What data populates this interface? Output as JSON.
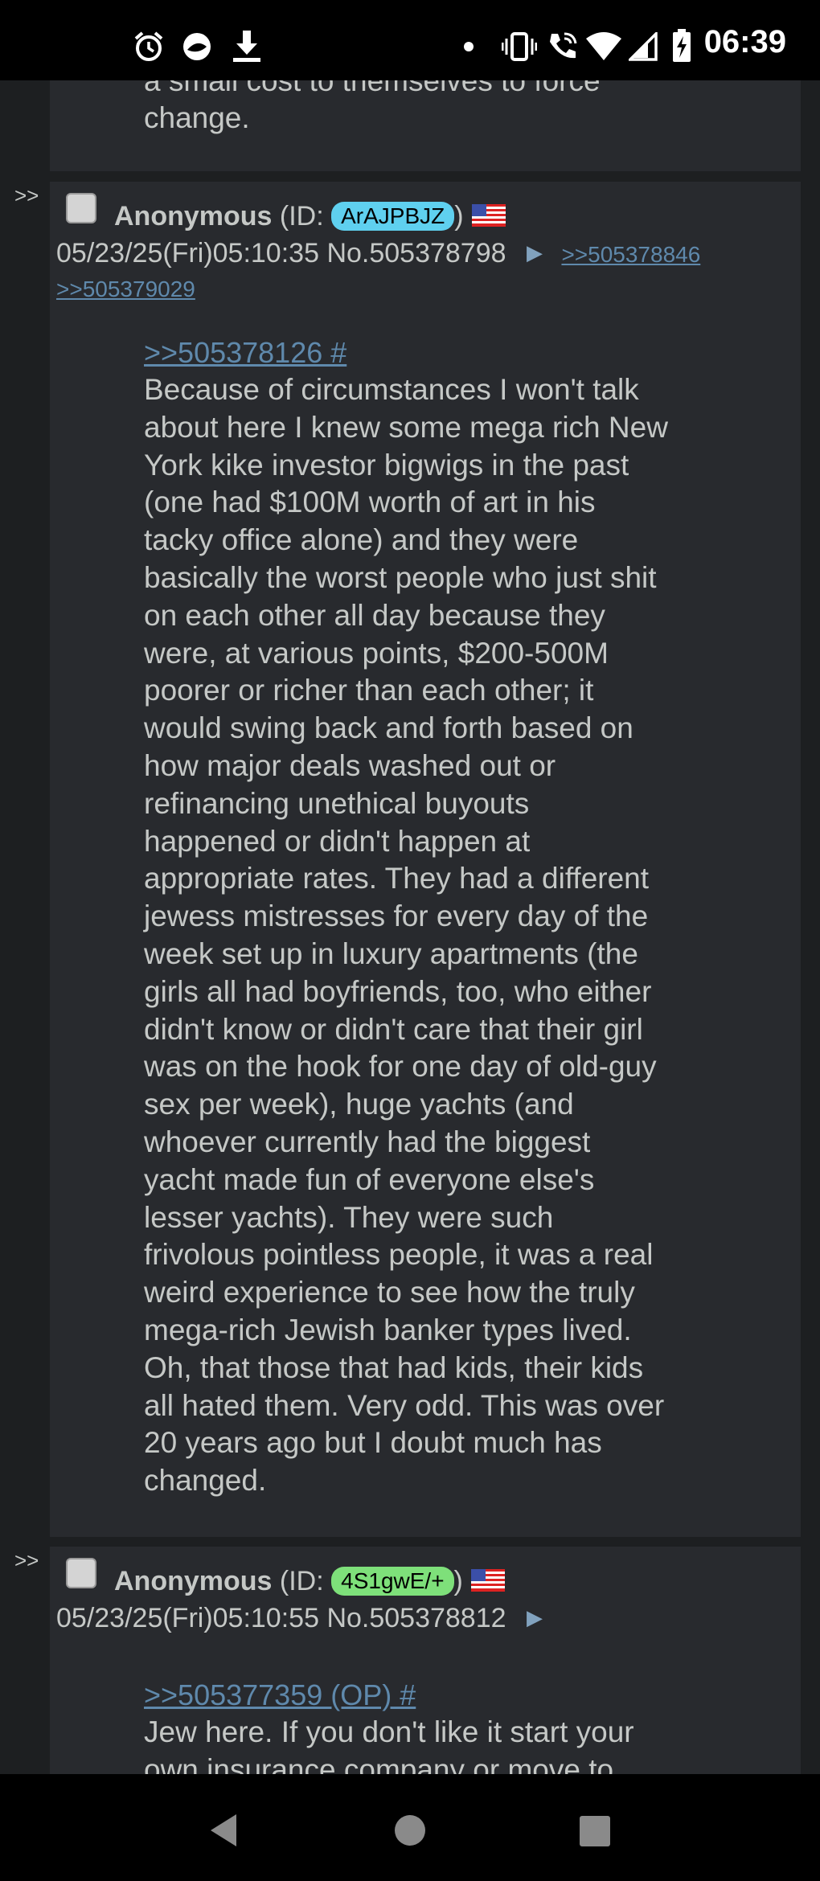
{
  "status_bar": {
    "time": "06:39",
    "icons": [
      "alarm-icon",
      "nfc-icon",
      "download-icon",
      "dot-icon",
      "vibrate-icon",
      "wifi-call-icon",
      "wifi-icon",
      "signal-icon",
      "battery-charging-icon"
    ]
  },
  "top_fragment": {
    "line1": "a small cost to themselves to force",
    "line2": "change."
  },
  "posts": [
    {
      "arrows": ">>",
      "name": "Anonymous",
      "id_prefix": "(ID: ",
      "id": "ArAJPBJZ",
      "id_suffix": ")",
      "id_color": "#5fd0ef",
      "datetime": "05/23/25(Fri)05:10:35",
      "number": "No.505378798",
      "arrow": "▶",
      "backlinks": [
        ">>505378846",
        ">>505379029"
      ],
      "quote": ">>505378126 #",
      "body": "Because of circumstances I won't talk\nabout here I knew some mega rich New\nYork kike investor bigwigs in the past\n(one had $100M worth of art in his\ntacky office alone) and they were\nbasically the worst people who just shit\non each other all day because they\nwere, at various points, $200-500M\npoorer or richer than each other; it\nwould swing back and forth based on\nhow major deals washed out or\nrefinancing unethical buyouts\nhappened or didn't happen at\nappropriate rates. They had a different\njewess mistresses for every day of the\nweek set up in luxury apartments (the\ngirls all had boyfriends, too, who either\ndidn't know or didn't care that their girl\nwas on the hook for one day of old-guy\nsex per week), huge yachts (and\nwhoever currently had the biggest\nyacht made fun of everyone else's\nlesser yachts). They were such\nfrivolous pointless people, it was a real\nweird experience to see how the truly\nmega-rich Jewish banker types lived.\nOh, that those that had kids, their kids\nall hated them. Very odd. This was over\n20 years ago but I doubt much has\nchanged."
    },
    {
      "arrows": ">>",
      "name": "Anonymous",
      "id_prefix": "(ID: ",
      "id": "4S1gwE/+",
      "id_suffix": ")",
      "id_color": "#7ee07a",
      "datetime": "05/23/25(Fri)05:10:55",
      "number": "No.505378812",
      "arrow": "▶",
      "quote": ">>505377359 (OP) #",
      "body": "Jew here. If you don't like it start your\nown insurance company or move to"
    }
  ],
  "nav_bar": {
    "buttons": [
      "back-icon",
      "home-icon",
      "recents-icon"
    ]
  }
}
